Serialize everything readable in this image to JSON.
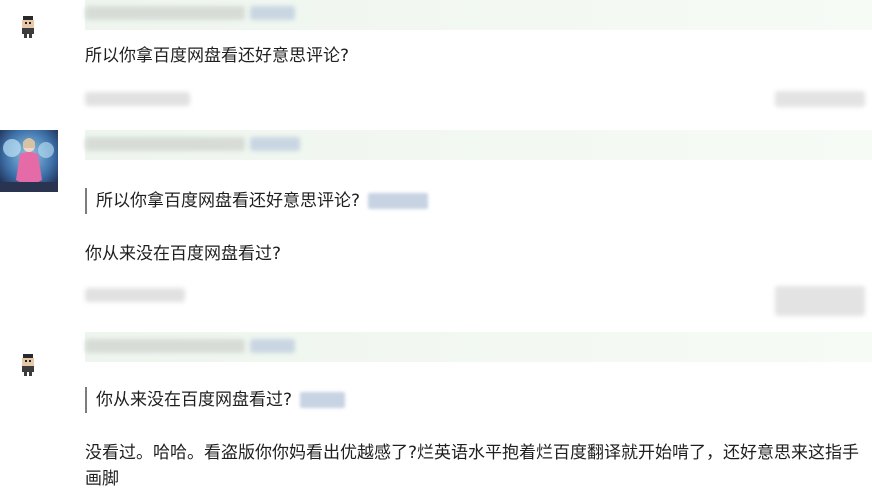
{
  "comments": [
    {
      "avatar_icon": "pixel-character-icon",
      "text": "所以你拿百度网盘看还好意思评论?",
      "colors": {
        "header_bar": "#eef5ee",
        "meta": "#c9d6e2"
      }
    },
    {
      "avatar_icon": "user-photo-avatar",
      "quote": "所以你拿百度网盘看还好意思评论?",
      "text": "你从来没在百度网盘看过?"
    },
    {
      "avatar_icon": "pixel-character-icon",
      "quote": "你从来没在百度网盘看过?",
      "text": "没看过。哈哈。看盗版你你妈看出优越感了?烂英语水平抱着烂百度翻译就开始啃了，还好意思来这指手画脚"
    }
  ]
}
